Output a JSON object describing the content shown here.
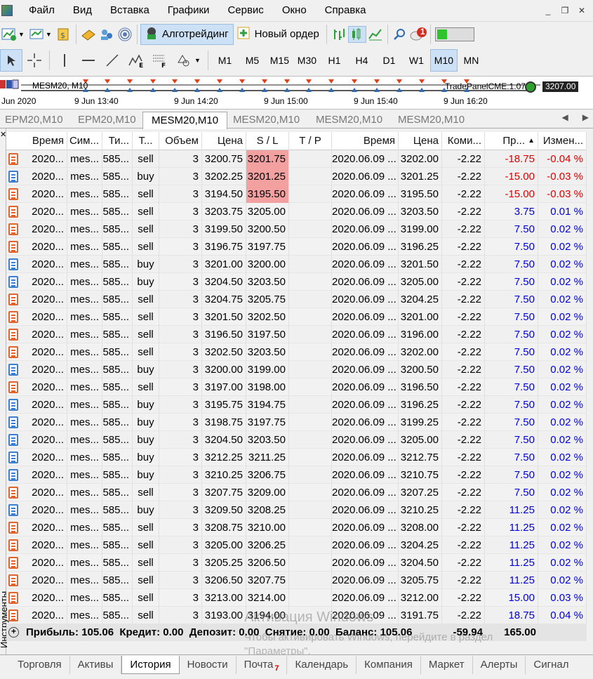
{
  "menu": [
    "Файл",
    "Вид",
    "Вставка",
    "Графики",
    "Сервис",
    "Окно",
    "Справка"
  ],
  "toolbar": {
    "algo": "Алготрейдинг",
    "new_order": "Новый ордер",
    "notif_count": "1"
  },
  "timeframes": [
    "M1",
    "M5",
    "M15",
    "M30",
    "H1",
    "H4",
    "D1",
    "W1",
    "M10",
    "MN"
  ],
  "strip": {
    "symbol": "MESM20, M10",
    "panel": "TradePanelCME.1.07",
    "price": "3207.00",
    "times": [
      "Jun 2020",
      "9 Jun 13:40",
      "9 Jun 14:20",
      "9 Jun 15:00",
      "9 Jun 15:40",
      "9 Jun 16:20"
    ]
  },
  "chart_tabs": [
    "EPM20,M10",
    "EPM20,M10",
    "MESM20,M10",
    "MESM20,M10",
    "MESM20,M10",
    "MESM20,M10"
  ],
  "headers": [
    "Время",
    "Сим...",
    "Ти...",
    "Т...",
    "Объем",
    "Цена",
    "S / L",
    "T / P",
    "Время",
    "Цена",
    "Коми...",
    "Пр...",
    "Измен..."
  ],
  "rows": [
    [
      "2020...",
      "mes...",
      "585...",
      "sell",
      "3",
      "3200.75",
      "3201.75",
      "",
      "2020.06.09 ...",
      "3202.00",
      "-2.22",
      "-18.75",
      "-0.04 %"
    ],
    [
      "2020...",
      "mes...",
      "585...",
      "buy",
      "3",
      "3202.25",
      "3201.25",
      "",
      "2020.06.09 ...",
      "3201.25",
      "-2.22",
      "-15.00",
      "-0.03 %"
    ],
    [
      "2020...",
      "mes...",
      "585...",
      "sell",
      "3",
      "3194.50",
      "3195.50",
      "",
      "2020.06.09 ...",
      "3195.50",
      "-2.22",
      "-15.00",
      "-0.03 %"
    ],
    [
      "2020...",
      "mes...",
      "585...",
      "sell",
      "3",
      "3203.75",
      "3205.00",
      "",
      "2020.06.09 ...",
      "3203.50",
      "-2.22",
      "3.75",
      "0.01 %"
    ],
    [
      "2020...",
      "mes...",
      "585...",
      "sell",
      "3",
      "3199.50",
      "3200.50",
      "",
      "2020.06.09 ...",
      "3199.00",
      "-2.22",
      "7.50",
      "0.02 %"
    ],
    [
      "2020...",
      "mes...",
      "585...",
      "sell",
      "3",
      "3196.75",
      "3197.75",
      "",
      "2020.06.09 ...",
      "3196.25",
      "-2.22",
      "7.50",
      "0.02 %"
    ],
    [
      "2020...",
      "mes...",
      "585...",
      "buy",
      "3",
      "3201.00",
      "3200.00",
      "",
      "2020.06.09 ...",
      "3201.50",
      "-2.22",
      "7.50",
      "0.02 %"
    ],
    [
      "2020...",
      "mes...",
      "585...",
      "buy",
      "3",
      "3204.50",
      "3203.50",
      "",
      "2020.06.09 ...",
      "3205.00",
      "-2.22",
      "7.50",
      "0.02 %"
    ],
    [
      "2020...",
      "mes...",
      "585...",
      "sell",
      "3",
      "3204.75",
      "3205.75",
      "",
      "2020.06.09 ...",
      "3204.25",
      "-2.22",
      "7.50",
      "0.02 %"
    ],
    [
      "2020...",
      "mes...",
      "585...",
      "sell",
      "3",
      "3201.50",
      "3202.50",
      "",
      "2020.06.09 ...",
      "3201.00",
      "-2.22",
      "7.50",
      "0.02 %"
    ],
    [
      "2020...",
      "mes...",
      "585...",
      "sell",
      "3",
      "3196.50",
      "3197.50",
      "",
      "2020.06.09 ...",
      "3196.00",
      "-2.22",
      "7.50",
      "0.02 %"
    ],
    [
      "2020...",
      "mes...",
      "585...",
      "sell",
      "3",
      "3202.50",
      "3203.50",
      "",
      "2020.06.09 ...",
      "3202.00",
      "-2.22",
      "7.50",
      "0.02 %"
    ],
    [
      "2020...",
      "mes...",
      "585...",
      "buy",
      "3",
      "3200.00",
      "3199.00",
      "",
      "2020.06.09 ...",
      "3200.50",
      "-2.22",
      "7.50",
      "0.02 %"
    ],
    [
      "2020...",
      "mes...",
      "585...",
      "sell",
      "3",
      "3197.00",
      "3198.00",
      "",
      "2020.06.09 ...",
      "3196.50",
      "-2.22",
      "7.50",
      "0.02 %"
    ],
    [
      "2020...",
      "mes...",
      "585...",
      "buy",
      "3",
      "3195.75",
      "3194.75",
      "",
      "2020.06.09 ...",
      "3196.25",
      "-2.22",
      "7.50",
      "0.02 %"
    ],
    [
      "2020...",
      "mes...",
      "585...",
      "buy",
      "3",
      "3198.75",
      "3197.75",
      "",
      "2020.06.09 ...",
      "3199.25",
      "-2.22",
      "7.50",
      "0.02 %"
    ],
    [
      "2020...",
      "mes...",
      "585...",
      "buy",
      "3",
      "3204.50",
      "3203.50",
      "",
      "2020.06.09 ...",
      "3205.00",
      "-2.22",
      "7.50",
      "0.02 %"
    ],
    [
      "2020...",
      "mes...",
      "585...",
      "buy",
      "3",
      "3212.25",
      "3211.25",
      "",
      "2020.06.09 ...",
      "3212.75",
      "-2.22",
      "7.50",
      "0.02 %"
    ],
    [
      "2020...",
      "mes...",
      "585...",
      "buy",
      "3",
      "3210.25",
      "3206.75",
      "",
      "2020.06.09 ...",
      "3210.75",
      "-2.22",
      "7.50",
      "0.02 %"
    ],
    [
      "2020...",
      "mes...",
      "585...",
      "sell",
      "3",
      "3207.75",
      "3209.00",
      "",
      "2020.06.09 ...",
      "3207.25",
      "-2.22",
      "7.50",
      "0.02 %"
    ],
    [
      "2020...",
      "mes...",
      "585...",
      "buy",
      "3",
      "3209.50",
      "3208.25",
      "",
      "2020.06.09 ...",
      "3210.25",
      "-2.22",
      "11.25",
      "0.02 %"
    ],
    [
      "2020...",
      "mes...",
      "585...",
      "sell",
      "3",
      "3208.75",
      "3210.00",
      "",
      "2020.06.09 ...",
      "3208.00",
      "-2.22",
      "11.25",
      "0.02 %"
    ],
    [
      "2020...",
      "mes...",
      "585...",
      "sell",
      "3",
      "3205.00",
      "3206.25",
      "",
      "2020.06.09 ...",
      "3204.25",
      "-2.22",
      "11.25",
      "0.02 %"
    ],
    [
      "2020...",
      "mes...",
      "585...",
      "sell",
      "3",
      "3205.25",
      "3206.50",
      "",
      "2020.06.09 ...",
      "3204.50",
      "-2.22",
      "11.25",
      "0.02 %"
    ],
    [
      "2020...",
      "mes...",
      "585...",
      "sell",
      "3",
      "3206.50",
      "3207.75",
      "",
      "2020.06.09 ...",
      "3205.75",
      "-2.22",
      "11.25",
      "0.02 %"
    ],
    [
      "2020...",
      "mes...",
      "585...",
      "sell",
      "3",
      "3213.00",
      "3214.00",
      "",
      "2020.06.09 ...",
      "3212.00",
      "-2.22",
      "15.00",
      "0.03 %"
    ],
    [
      "2020...",
      "mes...",
      "585...",
      "sell",
      "3",
      "3193.00",
      "3194.00",
      "",
      "2020.06.09 ...",
      "3191.75",
      "-2.22",
      "18.75",
      "0.04 %"
    ]
  ],
  "summary": {
    "text": "Прибыль: 105.06  Кредит: 0.00  Депозит: 0.00  Снятие: 0.00  Баланс: 105.06",
    "commission": "-59.94",
    "profit": "165.00"
  },
  "bottom_tabs": [
    "Торговля",
    "Активы",
    "История",
    "Новости",
    "Почта",
    "Календарь",
    "Компания",
    "Маркет",
    "Алерты",
    "Сигнал"
  ],
  "mail_badge": "7",
  "sidebar_label": "Инструменты",
  "watermark": {
    "line1": "Активация Windows",
    "line2": "Чтобы активировать Windows, перейдите в раздел",
    "line3": "\"Параметры\"."
  }
}
